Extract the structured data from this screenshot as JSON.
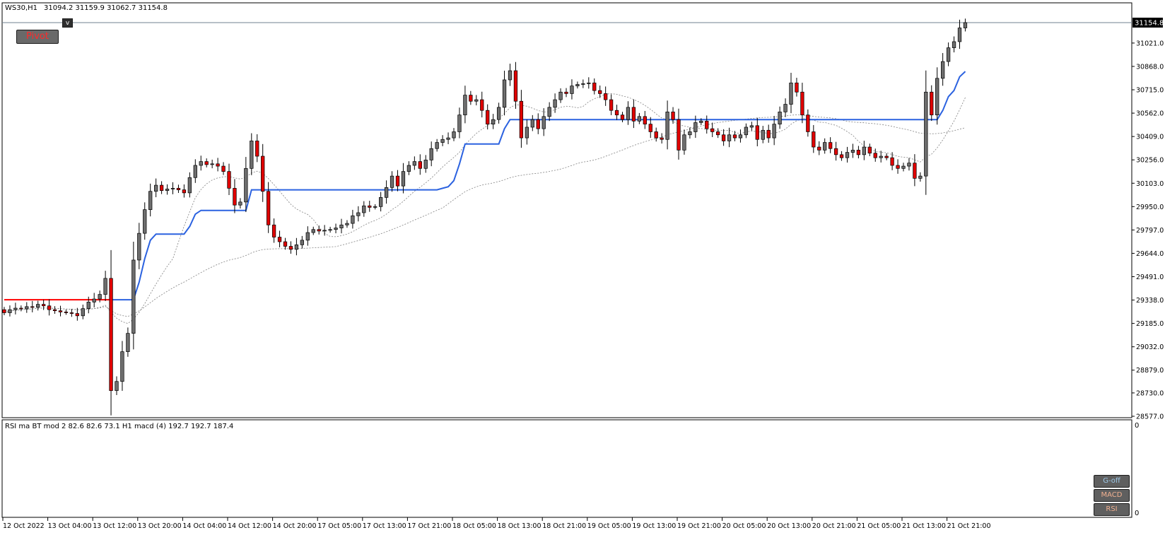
{
  "header": {
    "symbol": "WS30,H1",
    "ohlc": "31094.2 31159.9 31062.7 31154.8"
  },
  "buttons": {
    "pivot": "Pivot",
    "v": "v",
    "goff": "G-off",
    "macd": "MACD",
    "rsi": "RSI"
  },
  "indicator": {
    "label": "RSI ma BT mod 2 82.6 82.6 73.1  H1  macd (4) 192.7 192.7 187.4",
    "scale_top": "0",
    "scale_bottom": "0"
  },
  "colors": {
    "background": "#ffffff",
    "bull_candle": "#6e6e6e",
    "bear_candle": "#e00000",
    "wick": "#000000",
    "blue_line": "#2b62e0",
    "red_line": "#ff0000",
    "dotted_line": "#808080",
    "price_tag": "#000000"
  },
  "chart_data": {
    "type": "candlestick",
    "symbol": "WS30",
    "timeframe": "H1",
    "current_price": "31154.8",
    "y_ticks": [
      "31021.0",
      "30868.0",
      "30715.0",
      "30562.0",
      "30409.0",
      "30256.0",
      "30103.0",
      "29950.0",
      "29797.0",
      "29644.0",
      "29491.0",
      "29338.0",
      "29185.0",
      "29032.0",
      "28879.0",
      "28730.0",
      "28577.0"
    ],
    "x_ticks": [
      "12 Oct 2022",
      "13 Oct 04:00",
      "13 Oct 12:00",
      "13 Oct 20:00",
      "14 Oct 04:00",
      "14 Oct 12:00",
      "14 Oct 20:00",
      "17 Oct 05:00",
      "17 Oct 13:00",
      "17 Oct 21:00",
      "18 Oct 05:00",
      "18 Oct 13:00",
      "18 Oct 21:00",
      "19 Oct 05:00",
      "19 Oct 13:00",
      "19 Oct 21:00",
      "20 Oct 05:00",
      "20 Oct 13:00",
      "20 Oct 21:00",
      "21 Oct 05:00",
      "21 Oct 13:00",
      "21 Oct 21:00"
    ],
    "ylim": [
      28540,
      31310
    ],
    "candles_close": [
      29255,
      29275,
      29285,
      29280,
      29295,
      29290,
      29310,
      29300,
      29275,
      29268,
      29260,
      29255,
      29250,
      29235,
      29282,
      29325,
      29345,
      29375,
      29480,
      28745,
      28805,
      29000,
      29120,
      29600,
      29775,
      29930,
      30050,
      30090,
      30055,
      30065,
      30070,
      30060,
      30040,
      30140,
      30220,
      30245,
      30225,
      30230,
      30215,
      30180,
      30070,
      29960,
      29980,
      30200,
      30380,
      30280,
      30050,
      29830,
      29750,
      29720,
      29690,
      29670,
      29700,
      29730,
      29780,
      29800,
      29790,
      29795,
      29800,
      29810,
      29830,
      29840,
      29890,
      29910,
      29955,
      29945,
      29950,
      30010,
      30075,
      30150,
      30085,
      30180,
      30220,
      30245,
      30200,
      30255,
      30330,
      30370,
      30390,
      30400,
      30440,
      30550,
      30680,
      30640,
      30650,
      30580,
      30490,
      30520,
      30600,
      30780,
      30840,
      30640,
      30400,
      30470,
      30520,
      30460,
      30540,
      30600,
      30650,
      30700,
      30690,
      30740,
      30750,
      30755,
      30760,
      30710,
      30690,
      30650,
      30580,
      30550,
      30520,
      30600,
      30510,
      30540,
      30490,
      30440,
      30400,
      30390,
      30570,
      30520,
      30320,
      30420,
      30440,
      30500,
      30510,
      30460,
      30440,
      30420,
      30380,
      30420,
      30400,
      30420,
      30470,
      30480,
      30390,
      30450,
      30400,
      30490,
      30570,
      30620,
      30760,
      30700,
      30550,
      30440,
      30340,
      30320,
      30370,
      30330,
      30290,
      30270,
      30305,
      30320,
      30290,
      30340,
      30300,
      30270,
      30280,
      30270,
      30220,
      30200,
      30215,
      30235,
      30135,
      30150,
      30700,
      30550,
      30790,
      30900,
      30990,
      31030,
      31120,
      31154.8
    ]
  }
}
